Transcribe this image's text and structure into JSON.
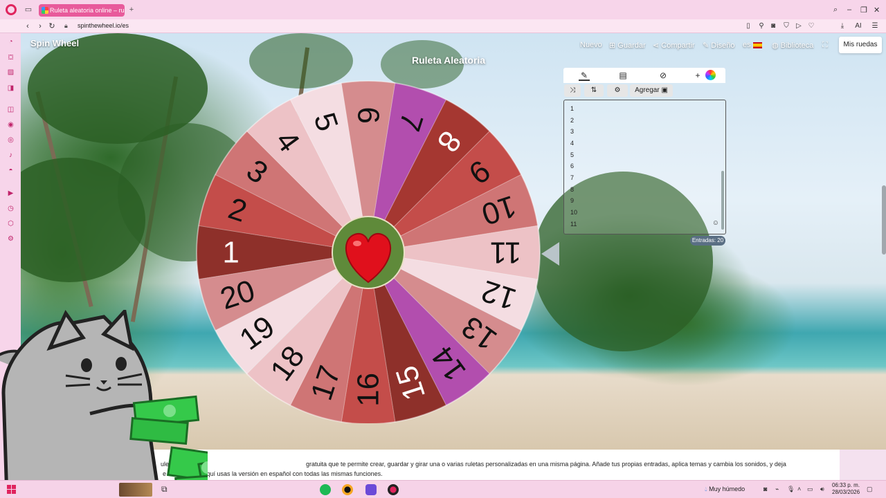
{
  "browser": {
    "tab_title": "Ruleta aleatoria online – ru",
    "url": "spinthewheel.io/es",
    "new_tab": "+",
    "ai_label": "AI"
  },
  "header": {
    "brand": "Spin Wheel",
    "title": "Ruleta Aleatoria",
    "nav": {
      "nuevo": "Nuevo",
      "guardar": "Guardar",
      "compartir": "Compartir",
      "diseno": "Diseño",
      "lang": "es",
      "biblioteca": "Biblioteca",
      "mis_ruedas": "Mis ruedas"
    }
  },
  "wheel": {
    "labels": [
      "1",
      "2",
      "3",
      "4",
      "5",
      "6",
      "7",
      "8",
      "9",
      "10",
      "11",
      "12",
      "13",
      "14",
      "15",
      "16",
      "17",
      "18",
      "19",
      "20"
    ],
    "colors": [
      "#8e302a",
      "#c44d4a",
      "#cf7575",
      "#edc2c6",
      "#f4dde2",
      "#d58c8e",
      "#b24eae",
      "#a53731",
      "#c44d4a",
      "#cf7575",
      "#edc2c6",
      "#f4dde2",
      "#d58c8e",
      "#b24eae",
      "#8e302a",
      "#c44d4a",
      "#cf7575",
      "#edc2c6",
      "#f4dde2",
      "#d58c8e"
    ]
  },
  "panel": {
    "agregar": "Agregar",
    "entries": [
      "1",
      "2",
      "3",
      "4",
      "5",
      "6",
      "7",
      "8",
      "9",
      "10",
      "11"
    ],
    "count": "Entradas: 20"
  },
  "description": {
    "line1a": "uleta online",
    "line1b": "gratuita que te permite crear, guardar y girar una o varias ruletas personalizadas en una misma página. Añade tus propias entradas, aplica temas y cambia los sonidos, y deja",
    "line2": "e Wheel, pero aquí usas la versión en español con todas las mismas funciones."
  },
  "taskbar": {
    "weather": "Muy húmedo",
    "time": "06:33 p. m.",
    "date": "28/03/2026"
  },
  "colors": {
    "accent": "#e0245e",
    "chrome": "#f7d5ea"
  },
  "icons": [
    "pencil-icon",
    "clipboard-icon",
    "eye-off-icon",
    "plus-icon",
    "shuffle-icon",
    "sort-icon",
    "gear-icon",
    "image-icon",
    "heart-icon",
    "cat-sticker"
  ]
}
